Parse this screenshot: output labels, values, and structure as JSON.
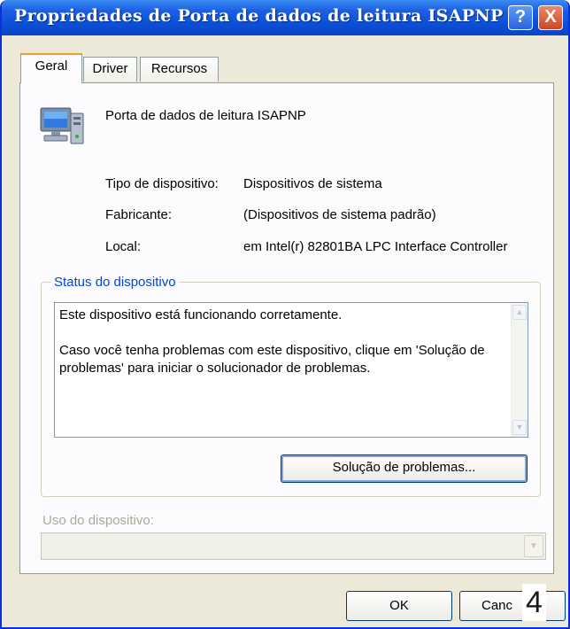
{
  "window": {
    "title": "Propriedades de Porta de dados de leitura ISAPNP"
  },
  "titlebar": {
    "help_label": "?",
    "close_label": "X"
  },
  "tabs": [
    {
      "label": "Geral",
      "active": true
    },
    {
      "label": "Driver",
      "active": false
    },
    {
      "label": "Recursos",
      "active": false
    }
  ],
  "device": {
    "icon": "computer-device-icon",
    "name": "Porta de dados de leitura ISAPNP",
    "properties": [
      {
        "label": "Tipo de dispositivo:",
        "value": "Dispositivos de sistema"
      },
      {
        "label": "Fabricante:",
        "value": "(Dispositivos de sistema padrão)"
      },
      {
        "label": "Local:",
        "value": "em Intel(r) 82801BA LPC Interface Controller"
      }
    ]
  },
  "status": {
    "legend": "Status do dispositivo",
    "text": "Este dispositivo está funcionando corretamente.\n\nCaso você tenha problemas com este dispositivo, clique em 'Solução de problemas' para iniciar o solucionador de problemas.",
    "troubleshoot_label": "Solução de problemas..."
  },
  "usage": {
    "label": "Uso do dispositivo:",
    "value": ""
  },
  "buttons": {
    "ok_label": "OK",
    "cancel_label": "Canc"
  },
  "overlay": {
    "number": "4"
  },
  "colors": {
    "titlebar": "#0a4fd6",
    "group_legend": "#0046d5",
    "tab_highlight": "#e6a02a",
    "dialog_bg": "#ece9d8"
  }
}
